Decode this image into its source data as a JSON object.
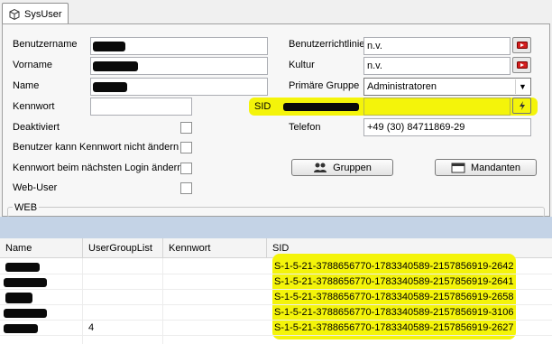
{
  "tab": {
    "label": "SysUser",
    "icon": "cube-icon"
  },
  "form": {
    "benutzername": {
      "label": "Benutzername",
      "value": ""
    },
    "vorname": {
      "label": "Vorname",
      "value": ""
    },
    "name": {
      "label": "Name",
      "value": ""
    },
    "kennwort": {
      "label": "Kennwort",
      "value": ""
    },
    "deaktiviert": {
      "label": "Deaktiviert",
      "checked": false
    },
    "kennwort_aendern": {
      "label": "Benutzer kann Kennwort nicht ändern",
      "checked": false
    },
    "kennwort_login": {
      "label": "Kennwort beim nächsten Login ändern",
      "checked": false
    },
    "web_user": {
      "label": "Web-User",
      "checked": false
    },
    "benutzerrichtlinie": {
      "label": "Benutzerrichtlinie",
      "value": "n.v."
    },
    "kultur": {
      "label": "Kultur",
      "value": "n.v."
    },
    "primaere_gruppe": {
      "label": "Primäre Gruppe",
      "value": "Administratoren"
    },
    "sid": {
      "label": "SID",
      "value": ""
    },
    "telefon": {
      "label": "Telefon",
      "value": "+49 (30) 84711869-29"
    },
    "gruppen_button": "Gruppen",
    "mandanten_button": "Mandanten",
    "web_group_label": "WEB"
  },
  "grid": {
    "columns": [
      "Name",
      "UserGroupList",
      "Kennwort",
      "SID"
    ],
    "rows": [
      {
        "name": "",
        "usergrouplist": "",
        "kennwort": "",
        "sid": "S-1-5-21-3788656770-1783340589-2157856919-2642"
      },
      {
        "name": "",
        "usergrouplist": "",
        "kennwort": "",
        "sid": "S-1-5-21-3788656770-1783340589-2157856919-2641"
      },
      {
        "name": "",
        "usergrouplist": "",
        "kennwort": "",
        "sid": "S-1-5-21-3788656770-1783340589-2157856919-2658"
      },
      {
        "name": "",
        "usergrouplist": "",
        "kennwort": "",
        "sid": "S-1-5-21-3788656770-1783340589-2157856919-3106"
      },
      {
        "name": "",
        "usergrouplist": "4",
        "kennwort": "",
        "sid": "S-1-5-21-3788656770-1783340589-2157856919-2627"
      }
    ]
  },
  "colors": {
    "highlight": "#f4f40a",
    "splitter": "#c4d3e6",
    "redact": "#0a0a0a"
  }
}
